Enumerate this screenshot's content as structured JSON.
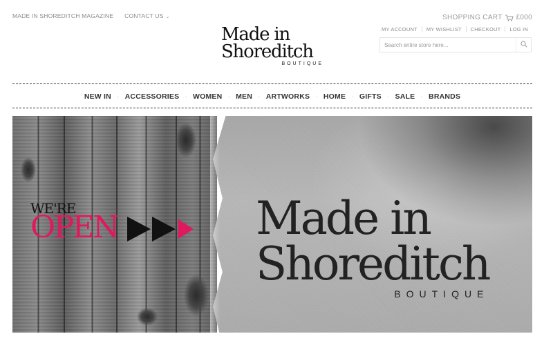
{
  "topbar": {
    "magazine_label": "MADE IN SHOREDITCH MAGAZINE",
    "contact_label": "CONTACT US"
  },
  "logo": {
    "line1": "Made in",
    "line2": "Shoreditch",
    "line3": "BOUTIQUE"
  },
  "cart": {
    "label": "SHOPPING CART",
    "amount": "£000"
  },
  "account_links": {
    "my_account": "MY ACCOUNT",
    "my_wishlist": "MY WISHLIST",
    "checkout": "CHECKOUT",
    "log_in": "LOG IN"
  },
  "search": {
    "placeholder": "Search entire store here..."
  },
  "nav": {
    "items": [
      "NEW IN",
      "ACCESSORIES",
      "WOMEN",
      "MEN",
      "ARTWORKS",
      "HOME",
      "GIFTS",
      "SALE",
      "BRANDS"
    ]
  },
  "banner": {
    "were": "WE'RE",
    "open": "OPEN",
    "title_line1": "Made in",
    "title_line2": "Shoreditch",
    "title_line3": "BOUTIQUE",
    "accent_color": "#e0195f"
  },
  "icons": {
    "cart": "shopping-cart-icon",
    "search": "search-icon",
    "chevron": "chevron-down-icon",
    "arrows": "play-arrows-icon"
  }
}
